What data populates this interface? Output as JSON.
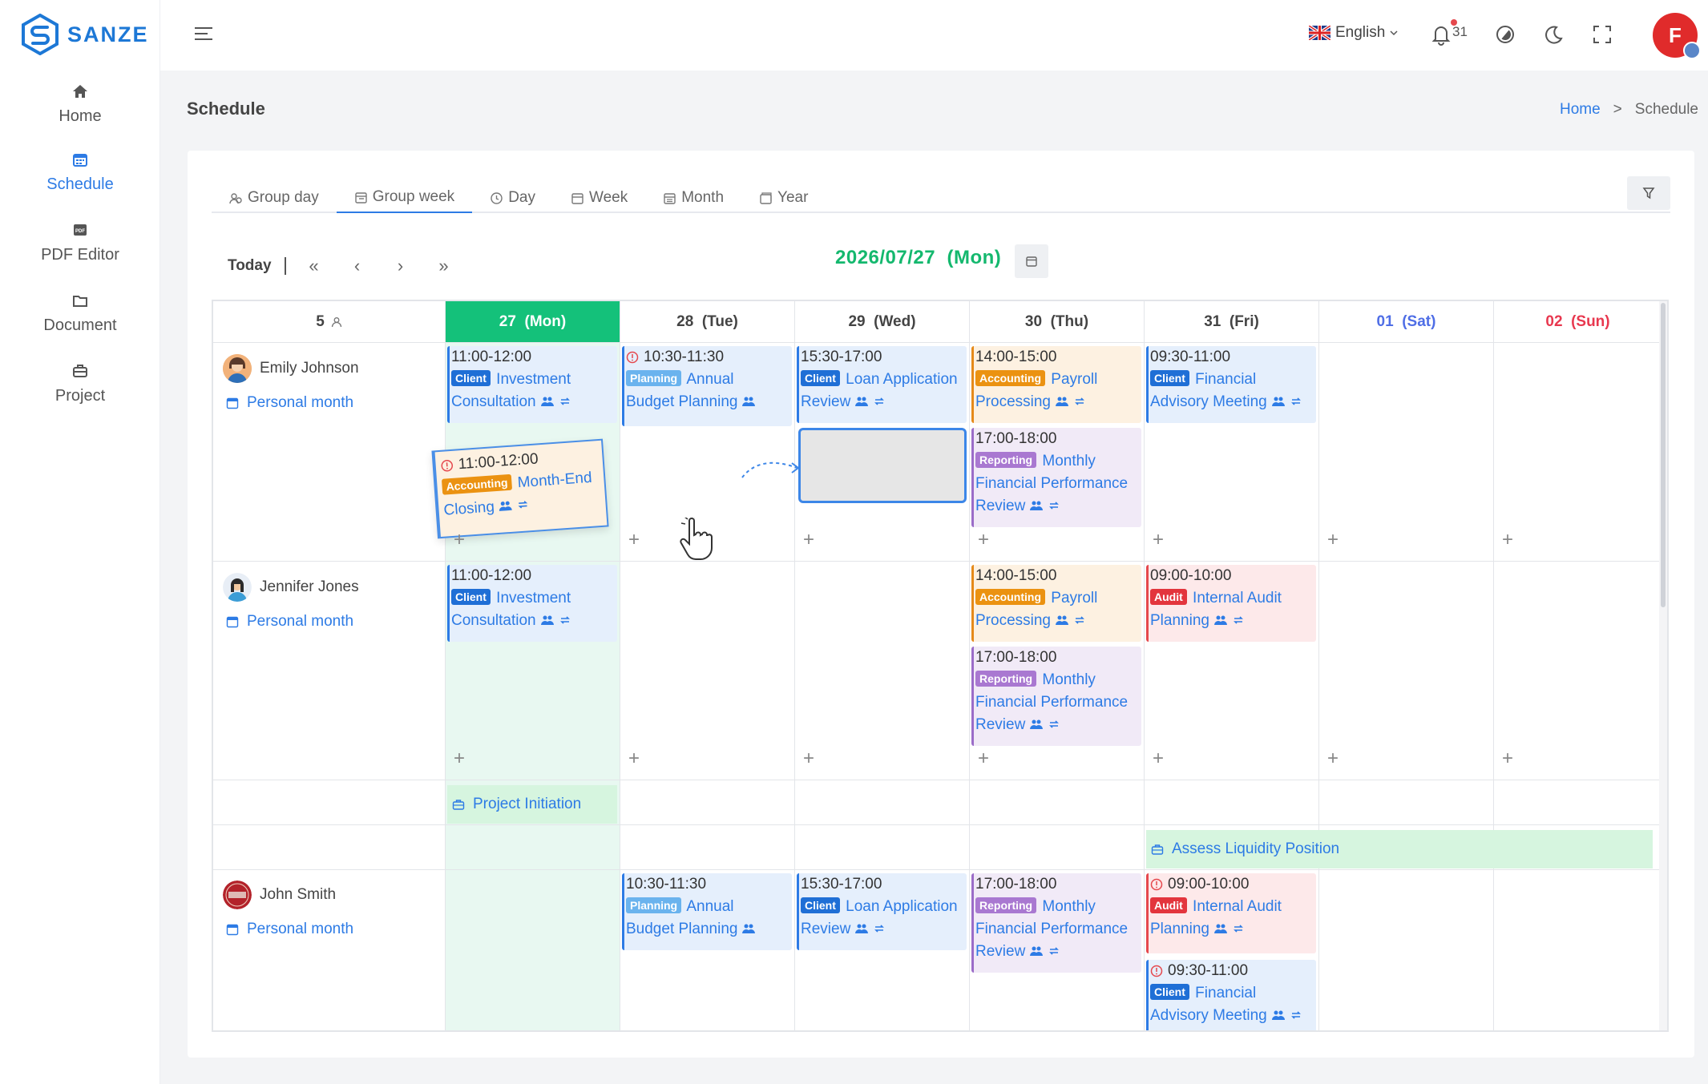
{
  "brand": {
    "name": "SANZE"
  },
  "sidebar": {
    "items": [
      {
        "label": "Home",
        "icon": "home-icon",
        "active": false
      },
      {
        "label": "Schedule",
        "icon": "calendar-icon",
        "active": true
      },
      {
        "label": "PDF Editor",
        "icon": "pdf-icon",
        "active": false
      },
      {
        "label": "Document",
        "icon": "folder-icon",
        "active": false
      },
      {
        "label": "Project",
        "icon": "briefcase-icon",
        "active": false
      }
    ]
  },
  "header": {
    "language": "English",
    "notification_count": "31",
    "user_initial": "F"
  },
  "page": {
    "title": "Schedule",
    "breadcrumb": {
      "home": "Home",
      "separator": ">",
      "current": "Schedule"
    }
  },
  "tabs": [
    "Group day",
    "Group week",
    "Day",
    "Week",
    "Month",
    "Year"
  ],
  "toolbar": {
    "today": "Today",
    "first": "«",
    "prev": "‹",
    "next": "›",
    "last": "»",
    "date_title": "2026/07/27  (Mon)"
  },
  "grid": {
    "corner": "5",
    "days": [
      {
        "label": "27  (Mon)",
        "type": "today"
      },
      {
        "label": "28  (Tue)",
        "type": "weekday"
      },
      {
        "label": "29  (Wed)",
        "type": "weekday"
      },
      {
        "label": "30  (Thu)",
        "type": "weekday"
      },
      {
        "label": "31  (Fri)",
        "type": "weekday"
      },
      {
        "label": "01  (Sat)",
        "type": "sat"
      },
      {
        "label": "02  (Sun)",
        "type": "sun"
      }
    ],
    "people": [
      {
        "name": "Emily Johnson",
        "link": "Personal month"
      },
      {
        "name": "Jennifer Jones",
        "link": "Personal month"
      },
      {
        "name": "John Smith",
        "link": "Personal month"
      }
    ],
    "projects": [
      {
        "label": "Project Initiation"
      },
      {
        "label": "Assess Liquidity Position"
      }
    ],
    "plus": "+"
  },
  "events": {
    "e1": {
      "time": "11:00-12:00",
      "tag": "Client",
      "title1": "Investment",
      "title2": "Consultation"
    },
    "e2": {
      "time": "10:30-11:30",
      "tag": "Planning",
      "title1": "Annual",
      "title2": "Budget Planning"
    },
    "e3": {
      "time": "15:30-17:00",
      "tag": "Client",
      "title1": "Loan Application",
      "title2": "Review"
    },
    "e4": {
      "time": "14:00-15:00",
      "tag": "Accounting",
      "title1": "Payroll",
      "title2": "Processing"
    },
    "e5": {
      "time": "09:30-11:00",
      "tag": "Client",
      "title1": "Financial",
      "title2": "Advisory Meeting"
    },
    "e6": {
      "time": "17:00-18:00",
      "tag": "Reporting",
      "title1": "Monthly",
      "title2": "Financial Performance",
      "title3": "Review"
    },
    "drag": {
      "time": "11:00-12:00",
      "tag": "Accounting",
      "title1": "Month-End",
      "title2": "Closing"
    },
    "j1": {
      "time": "11:00-12:00",
      "tag": "Client",
      "title1": "Investment",
      "title2": "Consultation"
    },
    "j2": {
      "time": "14:00-15:00",
      "tag": "Accounting",
      "title1": "Payroll",
      "title2": "Processing"
    },
    "j3": {
      "time": "09:00-10:00",
      "tag": "Audit",
      "title1": "Internal Audit",
      "title2": "Planning"
    },
    "j4": {
      "time": "17:00-18:00",
      "tag": "Reporting",
      "title1": "Monthly",
      "title2": "Financial Performance",
      "title3": "Review"
    },
    "s1": {
      "time": "10:30-11:30",
      "tag": "Planning",
      "title1": "Annual",
      "title2": "Budget Planning"
    },
    "s2": {
      "time": "15:30-17:00",
      "tag": "Client",
      "title1": "Loan Application",
      "title2": "Review"
    },
    "s3": {
      "time": "17:00-18:00",
      "tag": "Reporting",
      "title1": "Monthly",
      "title2": "Financial Performance",
      "title3": "Review"
    },
    "s4": {
      "time": "09:00-10:00",
      "tag": "Audit",
      "title1": "Internal Audit",
      "title2": "Planning"
    },
    "s5": {
      "time": "09:30-11:00",
      "tag": "Client",
      "title1": "Financial",
      "title2": "Advisory Meeting"
    }
  },
  "colors": {
    "accent": "#2d7be5",
    "today": "#14c17a",
    "sat": "#4f6ee6",
    "sun": "#e8384f"
  }
}
